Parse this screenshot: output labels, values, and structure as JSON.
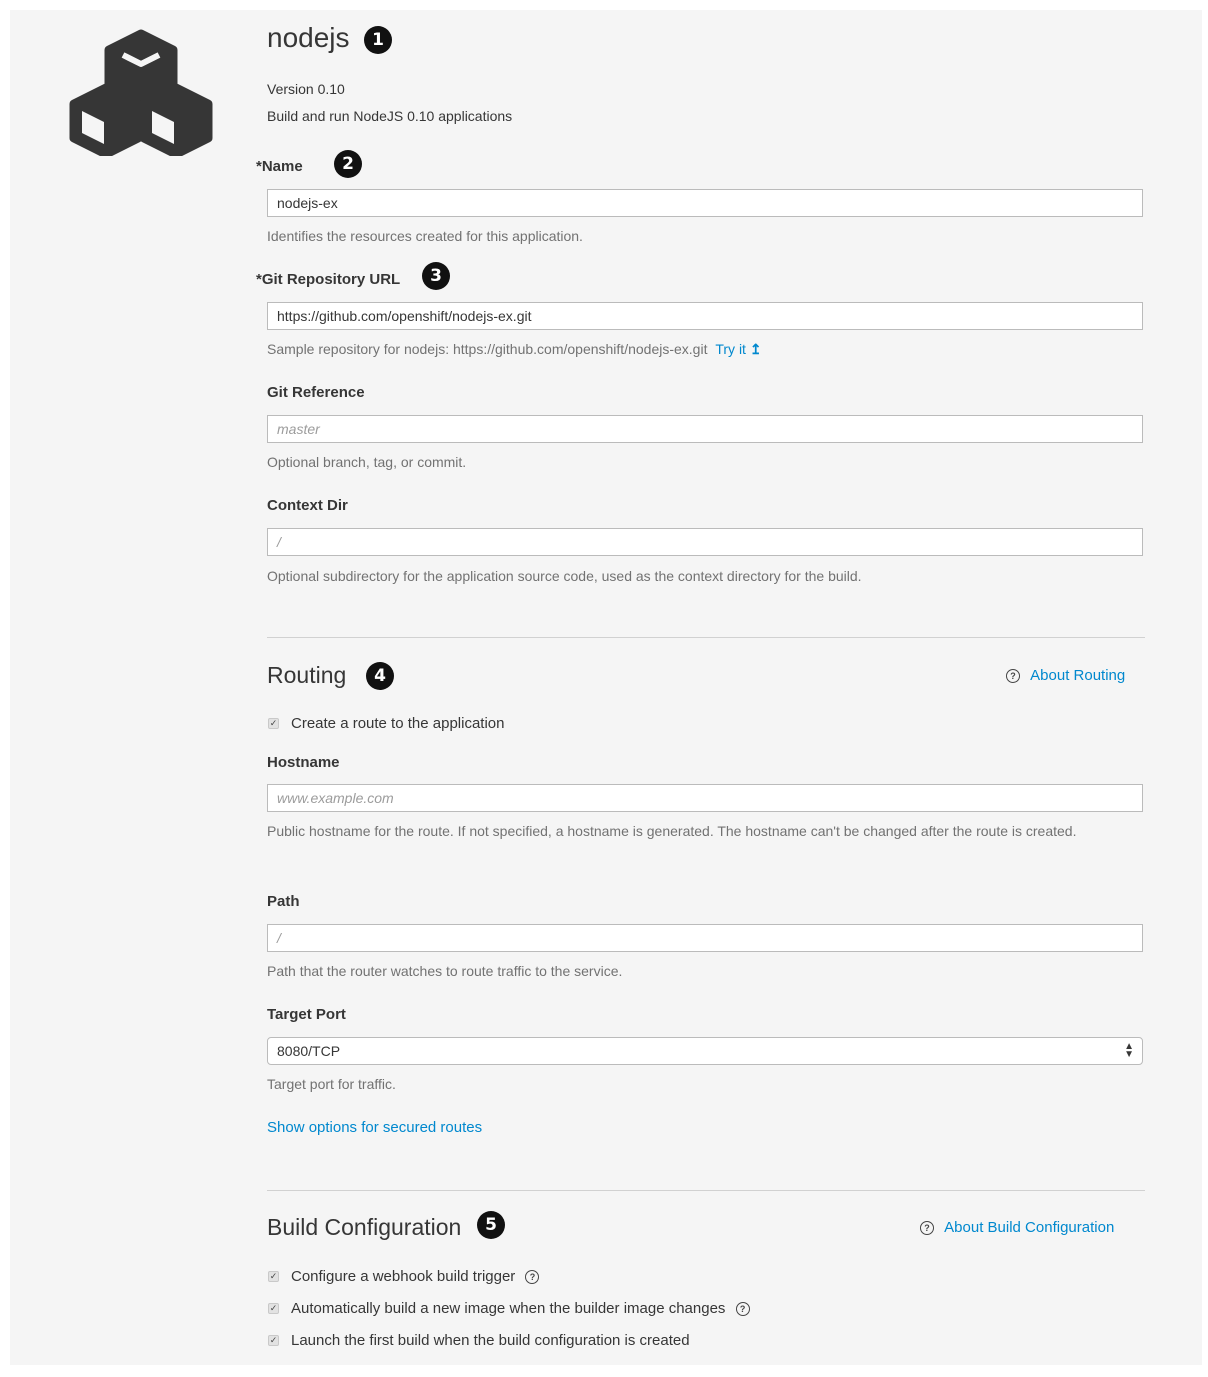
{
  "header": {
    "title": "nodejs",
    "badge": "1",
    "version": "Version 0.10",
    "description": "Build and run NodeJS 0.10 applications",
    "logo_icon": "cubes-icon"
  },
  "fields": {
    "name": {
      "required_mark": "*",
      "label": "Name",
      "badge": "2",
      "value": "nodejs-ex",
      "help": "Identifies the resources created for this application."
    },
    "git_url": {
      "required_mark": "*",
      "label": "Git Repository URL",
      "badge": "3",
      "value": "https://github.com/openshift/nodejs-ex.git",
      "help": "Sample repository for nodejs: https://github.com/openshift/nodejs-ex.git",
      "try_it": "Try it"
    },
    "git_ref": {
      "label": "Git Reference",
      "placeholder": "master",
      "help": "Optional branch, tag, or commit."
    },
    "context_dir": {
      "label": "Context Dir",
      "placeholder": "/",
      "help": "Optional subdirectory for the application source code, used as the context directory for the build."
    }
  },
  "routing": {
    "title": "Routing",
    "badge": "4",
    "about_link": "About Routing",
    "create_route_label": "Create a route to the application",
    "create_route_checked": true,
    "hostname": {
      "label": "Hostname",
      "placeholder": "www.example.com",
      "help": "Public hostname for the route. If not specified, a hostname is generated. The hostname can't be changed after the route is created."
    },
    "path": {
      "label": "Path",
      "placeholder": "/",
      "help": "Path that the router watches to route traffic to the service."
    },
    "target_port": {
      "label": "Target Port",
      "value": "8080/TCP",
      "help": "Target port for traffic."
    },
    "secured_link": "Show options for secured routes"
  },
  "build": {
    "title": "Build Configuration",
    "badge": "5",
    "about_link": "About Build Configuration",
    "options": [
      {
        "label": "Configure a webhook build trigger",
        "checked": true,
        "help_icon": true
      },
      {
        "label": "Automatically build a new image when the builder image changes",
        "checked": true,
        "help_icon": true
      },
      {
        "label": "Launch the first build when the build configuration is created",
        "checked": true,
        "help_icon": false
      }
    ]
  },
  "colors": {
    "link": "#0088ce",
    "panel_bg": "#f5f5f5"
  }
}
